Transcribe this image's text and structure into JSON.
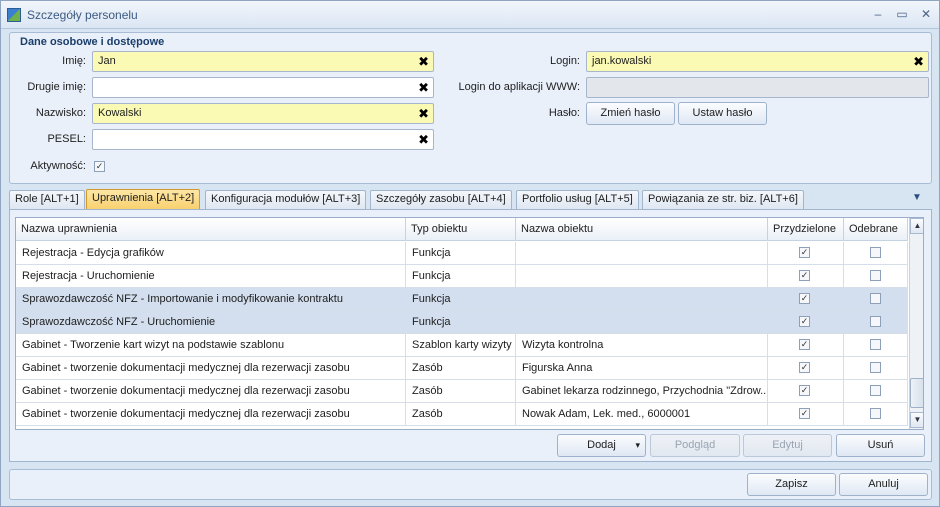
{
  "window": {
    "title": "Szczegóły personelu",
    "min": "–",
    "max": "▭",
    "close": "✕"
  },
  "personal": {
    "group_title": "Dane osobowe i dostępowe",
    "first_name_label": "Imię:",
    "first_name_value": "Jan",
    "second_name_label": "Drugie imię:",
    "second_name_value": "",
    "last_name_label": "Nazwisko:",
    "last_name_value": "Kowalski",
    "pesel_label": "PESEL:",
    "pesel_value": "",
    "active_label": "Aktywność:",
    "active_checked": true,
    "login_label": "Login:",
    "login_value": "jan.kowalski",
    "www_login_label": "Login do aplikacji WWW:",
    "www_login_value": "",
    "password_label": "Hasło:",
    "change_password": "Zmień hasło",
    "set_password": "Ustaw hasło",
    "clear_glyph": "✖"
  },
  "tabs": [
    {
      "label": "Role [ALT+1]",
      "active": false
    },
    {
      "label": "Uprawnienia [ALT+2]",
      "active": true
    },
    {
      "label": "Konfiguracja modułów [ALT+3]",
      "active": false
    },
    {
      "label": "Szczegóły zasobu [ALT+4]",
      "active": false
    },
    {
      "label": "Portfolio usług [ALT+5]",
      "active": false
    },
    {
      "label": "Powiązania ze str. biz. [ALT+6]",
      "active": false
    }
  ],
  "tab_overflow_glyph": "▼",
  "table": {
    "columns": [
      "Nazwa uprawnienia",
      "Typ obiektu",
      "Nazwa obiektu",
      "Przydzielone",
      "Odebrane"
    ],
    "rows": [
      {
        "name": "Rejestracja - Edycja grafików",
        "type": "Funkcja",
        "object": "",
        "assigned": true,
        "revoked": false,
        "selected": false
      },
      {
        "name": "Rejestracja - Uruchomienie",
        "type": "Funkcja",
        "object": "",
        "assigned": true,
        "revoked": false,
        "selected": false
      },
      {
        "name": "Sprawozdawczość NFZ - Importowanie i modyfikowanie kontraktu",
        "type": "Funkcja",
        "object": "",
        "assigned": true,
        "revoked": false,
        "selected": true
      },
      {
        "name": "Sprawozdawczość NFZ - Uruchomienie",
        "type": "Funkcja",
        "object": "",
        "assigned": true,
        "revoked": false,
        "selected": true
      },
      {
        "name": "Gabinet - Tworzenie kart wizyt na podstawie szablonu",
        "type": "Szablon karty wizyty",
        "object": "Wizyta kontrolna",
        "assigned": true,
        "revoked": false,
        "selected": false
      },
      {
        "name": "Gabinet - tworzenie dokumentacji medycznej dla rezerwacji zasobu",
        "type": "Zasób",
        "object": "Figurska Anna",
        "assigned": true,
        "revoked": false,
        "selected": false
      },
      {
        "name": "Gabinet - tworzenie dokumentacji medycznej dla rezerwacji zasobu",
        "type": "Zasób",
        "object": "Gabinet lekarza rodzinnego, Przychodnia \"Zdrow...",
        "assigned": true,
        "revoked": false,
        "selected": false
      },
      {
        "name": "Gabinet - tworzenie dokumentacji medycznej dla rezerwacji zasobu",
        "type": "Zasób",
        "object": "Nowak Adam, Lek. med., 6000001",
        "assigned": true,
        "revoked": false,
        "selected": false
      }
    ]
  },
  "grid_buttons": {
    "add": "Dodaj",
    "add_dropdown": "▾",
    "preview": "Podgląd",
    "edit": "Edytuj",
    "delete": "Usuń"
  },
  "scroll": {
    "up": "▲",
    "down": "▼",
    "grip": "≡"
  },
  "footer": {
    "save": "Zapisz",
    "cancel": "Anuluj"
  },
  "check_glyph": "✓"
}
